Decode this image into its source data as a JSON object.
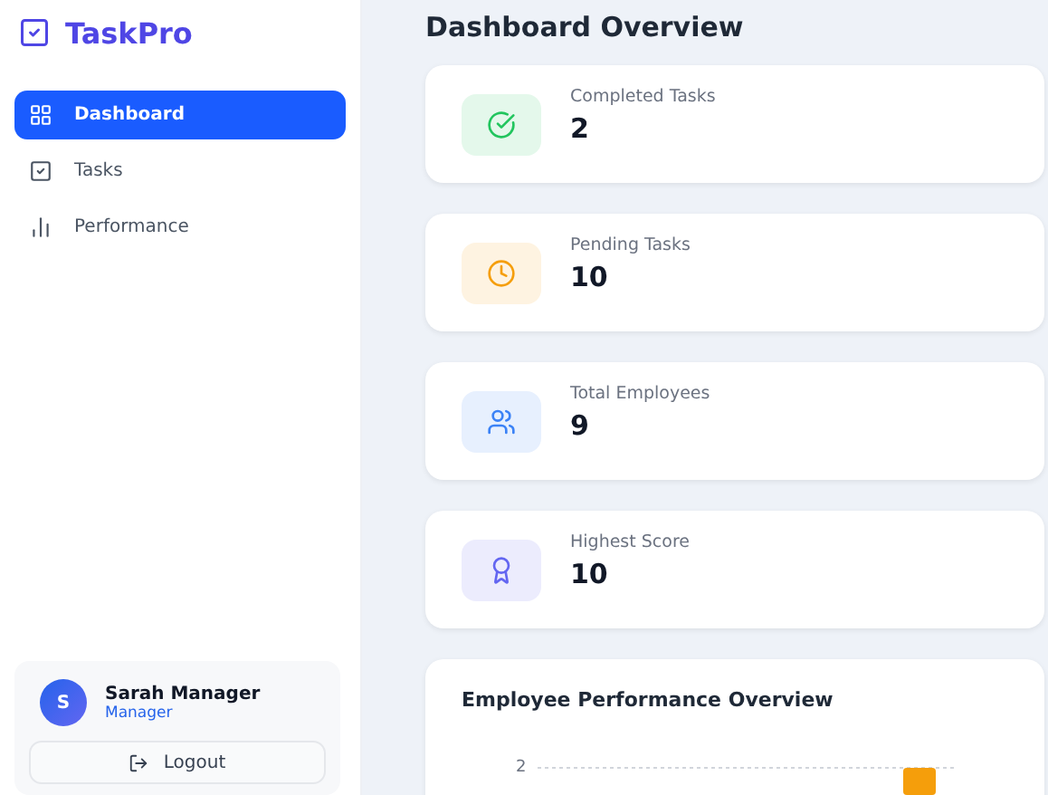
{
  "brand": {
    "name": "TaskPro"
  },
  "nav": [
    {
      "label": "Dashboard",
      "selected": true
    },
    {
      "label": "Tasks",
      "selected": false
    },
    {
      "label": "Performance",
      "selected": false
    }
  ],
  "user": {
    "initial": "S",
    "name": "Sarah Manager",
    "role": "Manager"
  },
  "logout": {
    "label": "Logout"
  },
  "page": {
    "title": "Dashboard Overview"
  },
  "stats": [
    {
      "label": "Completed Tasks",
      "value": "2",
      "color": "#22c55e"
    },
    {
      "label": "Pending Tasks",
      "value": "10",
      "color": "#f59e0b"
    },
    {
      "label": "Total Employees",
      "value": "9",
      "color": "#3b82f6"
    },
    {
      "label": "Highest Score",
      "value": "10",
      "color": "#6366f1"
    }
  ],
  "performance": {
    "title": "Employee Performance Overview",
    "axis_tick": "2"
  }
}
